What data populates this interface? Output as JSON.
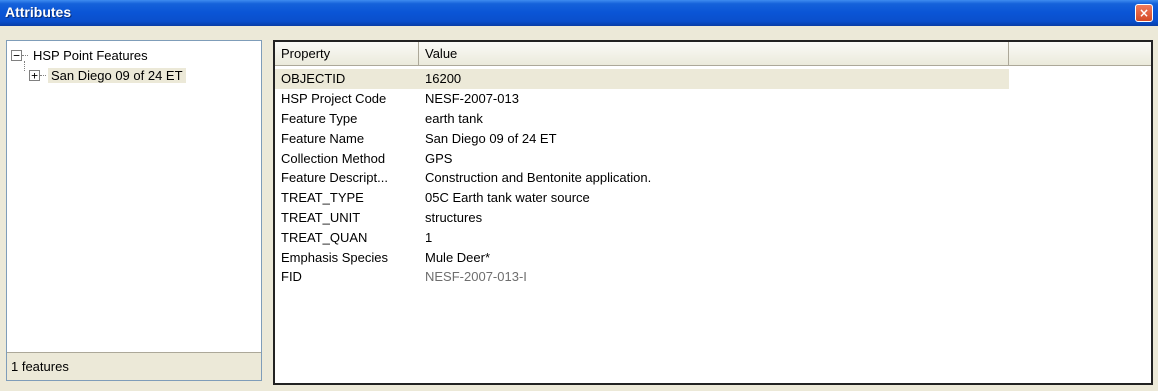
{
  "window": {
    "title": "Attributes",
    "close_glyph": "×"
  },
  "tree": {
    "root": {
      "toggle": "−",
      "label": "HSP Point Features"
    },
    "child": {
      "toggle": "+",
      "label": "San Diego 09 of 24 ET"
    }
  },
  "status": {
    "text": "1 features"
  },
  "table": {
    "headers": {
      "property": "Property",
      "value": "Value"
    },
    "rows": [
      {
        "property": "OBJECTID",
        "value": "16200"
      },
      {
        "property": "HSP Project Code",
        "value": "NESF-2007-013"
      },
      {
        "property": "Feature Type",
        "value": "earth tank"
      },
      {
        "property": "Feature Name",
        "value": "San Diego 09 of 24 ET"
      },
      {
        "property": "Collection Method",
        "value": "GPS"
      },
      {
        "property": "Feature Descript...",
        "value": "Construction and Bentonite application."
      },
      {
        "property": "TREAT_TYPE",
        "value": "05C Earth tank water source"
      },
      {
        "property": "TREAT_UNIT",
        "value": "structures"
      },
      {
        "property": "TREAT_QUAN",
        "value": "1"
      },
      {
        "property": "Emphasis Species",
        "value": "Mule Deer*"
      },
      {
        "property": "FID",
        "value": "NESF-2007-013-I"
      }
    ]
  },
  "colors": {
    "titlebar": "#0A55D6",
    "selection": "#ECE9D8",
    "readonly_text": "#6E6E6E"
  }
}
